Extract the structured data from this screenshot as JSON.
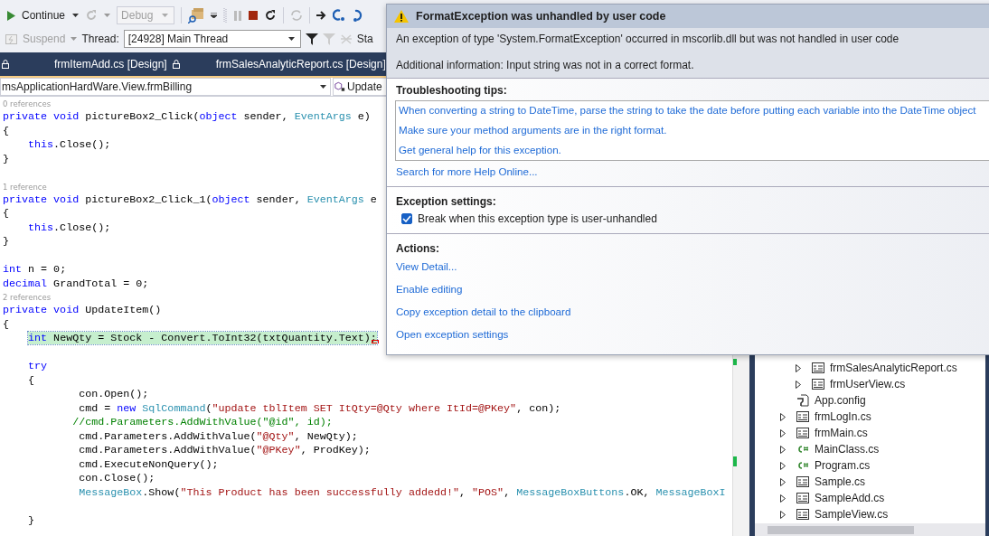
{
  "toolbar": {
    "continue_button": {
      "label": "Continue"
    },
    "configuration": {
      "value": "Debug",
      "disabled": true
    },
    "suspend_button": {
      "label": "Suspend",
      "disabled": true
    },
    "thread": {
      "label": "Thread:",
      "value": "[24928] Main Thread"
    },
    "stack_label": "Sta"
  },
  "document_tabs": [
    {
      "label": "frmItemAdd.cs [Design]",
      "selected": false
    },
    {
      "label": "frmSalesAnalyticReport.cs [Design]",
      "selected": false
    }
  ],
  "navigation": {
    "type_dropdown": "msApplicationHardWare.View.frmBilling",
    "member_dropdown": "Update"
  },
  "code_lines": [
    {
      "kind": "lens",
      "text": "0 references"
    },
    {
      "kind": "code",
      "tokens": [
        {
          "kind": "keyword",
          "text": "private void"
        },
        {
          "kind": "plain",
          "text": " pictureBox2_Click("
        },
        {
          "kind": "keyword",
          "text": "object"
        },
        {
          "kind": "plain",
          "text": " sender, "
        },
        {
          "kind": "type",
          "text": "EventArgs"
        },
        {
          "kind": "plain",
          "text": " e)"
        }
      ]
    },
    {
      "kind": "code",
      "tokens": [
        {
          "kind": "plain",
          "text": "{"
        }
      ]
    },
    {
      "kind": "code",
      "tokens": [
        {
          "kind": "keyword",
          "text": "    this"
        },
        {
          "kind": "plain",
          "text": ".Close();"
        }
      ]
    },
    {
      "kind": "code",
      "tokens": [
        {
          "kind": "plain",
          "text": "}"
        }
      ]
    },
    {
      "kind": "blank"
    },
    {
      "kind": "lens",
      "text": "1 reference"
    },
    {
      "kind": "code",
      "tokens": [
        {
          "kind": "keyword",
          "text": "private void"
        },
        {
          "kind": "plain",
          "text": " pictureBox2_Click_1("
        },
        {
          "kind": "keyword",
          "text": "object"
        },
        {
          "kind": "plain",
          "text": " sender, "
        },
        {
          "kind": "type",
          "text": "EventArgs"
        },
        {
          "kind": "plain",
          "text": " e"
        }
      ]
    },
    {
      "kind": "code",
      "tokens": [
        {
          "kind": "plain",
          "text": "{"
        }
      ]
    },
    {
      "kind": "code",
      "tokens": [
        {
          "kind": "keyword",
          "text": "    this"
        },
        {
          "kind": "plain",
          "text": ".Close();"
        }
      ]
    },
    {
      "kind": "code",
      "tokens": [
        {
          "kind": "plain",
          "text": "}"
        }
      ]
    },
    {
      "kind": "blank"
    },
    {
      "kind": "code",
      "tokens": [
        {
          "kind": "keyword",
          "text": "int"
        },
        {
          "kind": "plain",
          "text": " n = 0;"
        }
      ]
    },
    {
      "kind": "code",
      "tokens": [
        {
          "kind": "keyword",
          "text": "decimal"
        },
        {
          "kind": "plain",
          "text": " GrandTotal = 0;"
        }
      ]
    },
    {
      "kind": "lens",
      "text": "2 references"
    },
    {
      "kind": "code",
      "tokens": [
        {
          "kind": "keyword",
          "text": "private void"
        },
        {
          "kind": "plain",
          "text": " UpdateItem()"
        }
      ]
    },
    {
      "kind": "code",
      "tokens": [
        {
          "kind": "plain",
          "text": "{"
        }
      ]
    },
    {
      "kind": "current",
      "tokens": [
        {
          "kind": "keyword",
          "text": "    int"
        },
        {
          "kind": "plain",
          "text": " NewQty = Stock - Convert.ToInt32(txtQuantity.Text);"
        }
      ]
    },
    {
      "kind": "blank"
    },
    {
      "kind": "code",
      "tokens": [
        {
          "kind": "keyword",
          "text": "    try"
        }
      ]
    },
    {
      "kind": "code",
      "tokens": [
        {
          "kind": "plain",
          "text": "    {"
        }
      ]
    },
    {
      "kind": "code",
      "tokens": [
        {
          "kind": "plain",
          "text": "            con.Open();"
        }
      ]
    },
    {
      "kind": "code",
      "tokens": [
        {
          "kind": "plain",
          "text": "            cmd = "
        },
        {
          "kind": "keyword",
          "text": "new"
        },
        {
          "kind": "type",
          "text": " SqlCommand"
        },
        {
          "kind": "plain",
          "text": "("
        },
        {
          "kind": "string",
          "text": "\"update tblItem SET ItQty=@Qty where ItId=@PKey\""
        },
        {
          "kind": "plain",
          "text": ", con);"
        }
      ]
    },
    {
      "kind": "code",
      "tokens": [
        {
          "kind": "comment",
          "text": "           //cmd.Parameters.AddWithValue(\"@id\", id);"
        }
      ]
    },
    {
      "kind": "code",
      "tokens": [
        {
          "kind": "plain",
          "text": "            cmd.Parameters.AddWithValue("
        },
        {
          "kind": "string",
          "text": "\"@Qty\""
        },
        {
          "kind": "plain",
          "text": ", NewQty);"
        }
      ]
    },
    {
      "kind": "code",
      "tokens": [
        {
          "kind": "plain",
          "text": "            cmd.Parameters.AddWithValue("
        },
        {
          "kind": "string",
          "text": "\"@PKey\""
        },
        {
          "kind": "plain",
          "text": ", ProdKey);"
        }
      ]
    },
    {
      "kind": "code",
      "tokens": [
        {
          "kind": "plain",
          "text": "            cmd.ExecuteNonQuery();"
        }
      ]
    },
    {
      "kind": "code",
      "tokens": [
        {
          "kind": "plain",
          "text": "            con.Close();"
        }
      ]
    },
    {
      "kind": "code",
      "tokens": [
        {
          "kind": "type",
          "text": "            MessageBox"
        },
        {
          "kind": "plain",
          "text": ".Show("
        },
        {
          "kind": "string",
          "text": "\"This Product has been successfully addedd!\""
        },
        {
          "kind": "plain",
          "text": ", "
        },
        {
          "kind": "string",
          "text": "\"POS\""
        },
        {
          "kind": "plain",
          "text": ", "
        },
        {
          "kind": "type",
          "text": "MessageBoxButtons"
        },
        {
          "kind": "plain",
          "text": ".OK, "
        },
        {
          "kind": "type",
          "text": "MessageBoxI"
        }
      ]
    },
    {
      "kind": "blank"
    },
    {
      "kind": "code",
      "tokens": [
        {
          "kind": "plain",
          "text": "    }"
        }
      ]
    }
  ],
  "exception_popup": {
    "title": "FormatException was unhandled by user code",
    "message": "An exception of type 'System.FormatException' occurred in mscorlib.dll but was not handled in user code",
    "additional_info": "Additional information: Input string was not in a correct format.",
    "troubleshooting": {
      "heading": "Troubleshooting tips:",
      "tips": [
        "When converting a string to DateTime, parse the string to take the date before putting each variable into the DateTime object",
        "Make sure your method arguments are in the right format.",
        "Get general help for this exception."
      ]
    },
    "search_link": "Search for more Help Online...",
    "settings": {
      "heading": "Exception settings:",
      "checkbox": {
        "label": "Break when this exception type is user-unhandled",
        "checked": true
      }
    },
    "actions": {
      "heading": "Actions:",
      "links": [
        "View Detail...",
        "Enable editing",
        "Copy exception detail to the clipboard",
        "Open exception settings"
      ]
    }
  },
  "solution_explorer": {
    "nested_items": [
      {
        "label": "frmSalesAnalyticReport.cs",
        "kind": "form",
        "expandable": true
      },
      {
        "label": "frmUserView.cs",
        "kind": "form",
        "expandable": true
      }
    ],
    "items": [
      {
        "label": "App.config",
        "kind": "config",
        "expandable": false
      },
      {
        "label": "frmLogIn.cs",
        "kind": "form",
        "expandable": true
      },
      {
        "label": "frmMain.cs",
        "kind": "form",
        "expandable": true
      },
      {
        "label": "MainClass.cs",
        "kind": "csharp",
        "expandable": true
      },
      {
        "label": "Program.cs",
        "kind": "csharp",
        "expandable": true
      },
      {
        "label": "Sample.cs",
        "kind": "form",
        "expandable": true
      },
      {
        "label": "SampleAdd.cs",
        "kind": "form",
        "expandable": true
      },
      {
        "label": "SampleView.cs",
        "kind": "form",
        "expandable": true
      }
    ]
  }
}
